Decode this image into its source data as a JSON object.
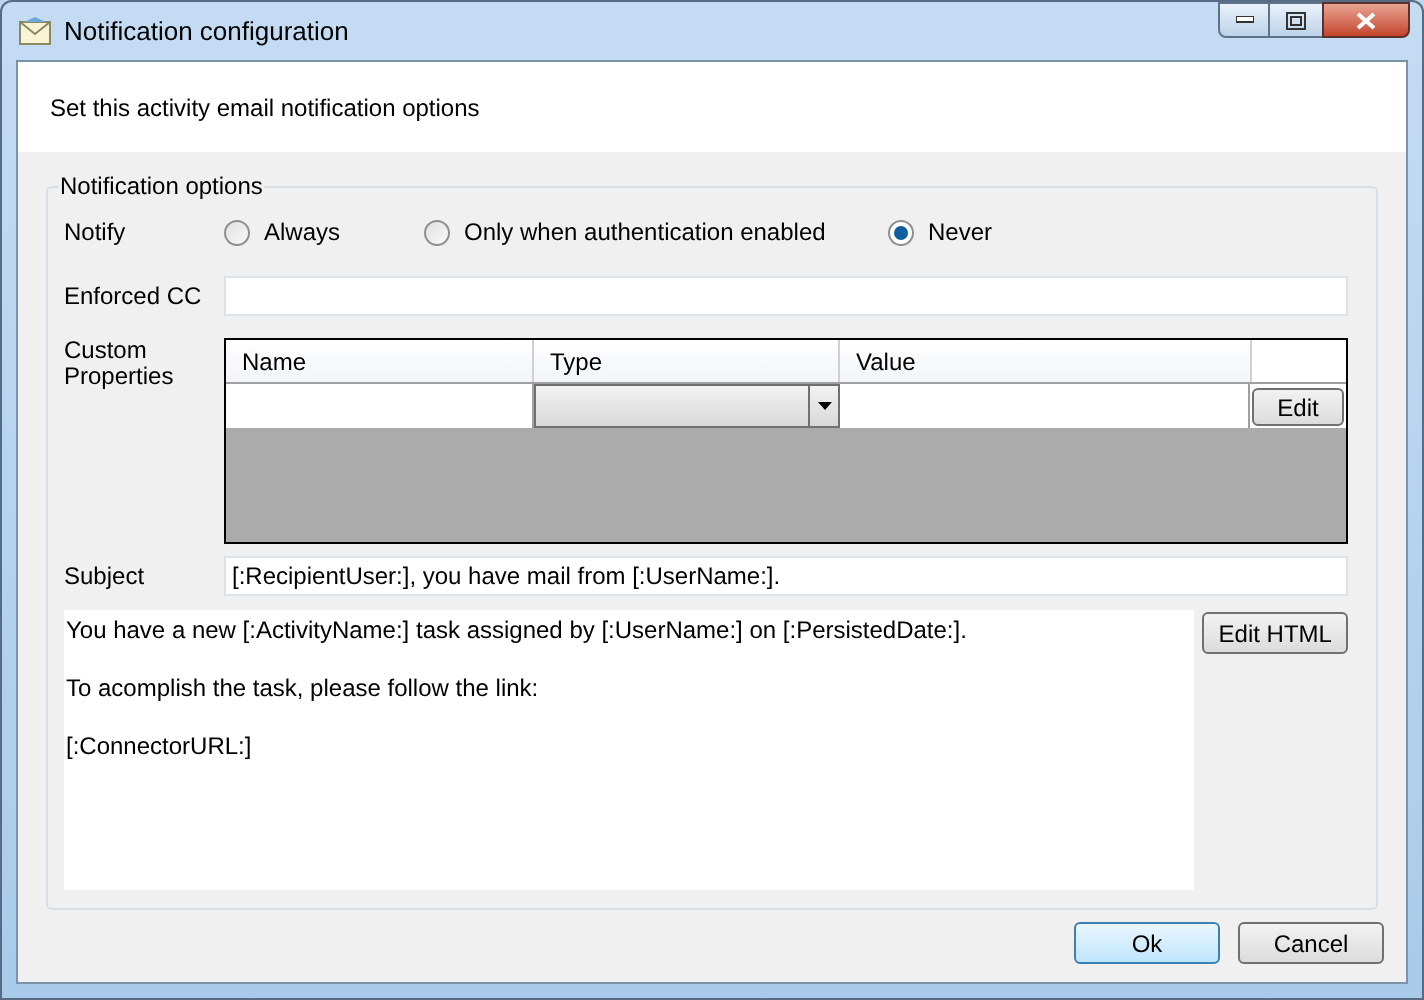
{
  "window": {
    "title": "Notification configuration"
  },
  "header": {
    "text": "Set this activity email notification options"
  },
  "group": {
    "title": "Notification options"
  },
  "notify": {
    "label": "Notify",
    "options": [
      {
        "label": "Always",
        "selected": false
      },
      {
        "label": "Only when authentication enabled",
        "selected": false
      },
      {
        "label": "Never",
        "selected": true
      }
    ]
  },
  "enforced_cc": {
    "label": "Enforced CC"
  },
  "custom_properties": {
    "label": "Custom Properties",
    "columns": [
      "Name",
      "Type",
      "Value"
    ],
    "row_button": "Edit"
  },
  "subject": {
    "label": "Subject",
    "value": "[:RecipientUser:], you have mail from [:UserName:]."
  },
  "body": {
    "paragraphs": [
      "You have a new [:ActivityName:] task assigned by [:UserName:] on [:PersistedDate:].",
      "To acomplish the task, please follow the link:",
      "[:ConnectorURL:]"
    ]
  },
  "edit_html_button": "Edit HTML",
  "buttons": [
    {
      "label": "Ok",
      "default": true
    },
    {
      "label": "Cancel",
      "default": false
    }
  ]
}
